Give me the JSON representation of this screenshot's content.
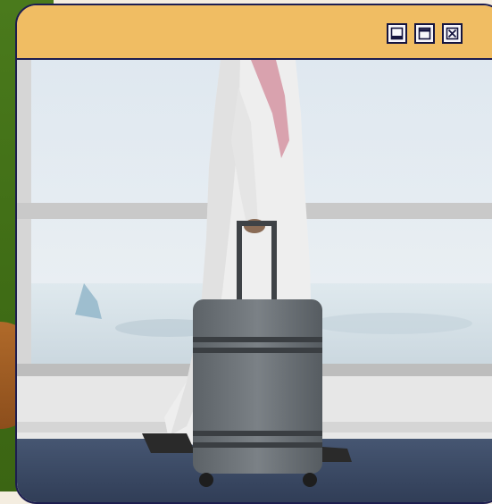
{
  "window": {
    "titlebar_color": "#f0bd63",
    "border_color": "#1d1d4f",
    "controls": [
      {
        "name": "minimize",
        "icon": "minimize-icon"
      },
      {
        "name": "maximize",
        "icon": "maximize-icon"
      },
      {
        "name": "close",
        "icon": "close-icon"
      }
    ]
  },
  "photo": {
    "subject": "traveler-with-suitcase",
    "colors": {
      "sky": "#dde6ee",
      "window_frame": "#cfcfcf",
      "robe": "#eeeeee",
      "suitcase": "#6d7378",
      "carpet": "#3c4c66"
    }
  }
}
